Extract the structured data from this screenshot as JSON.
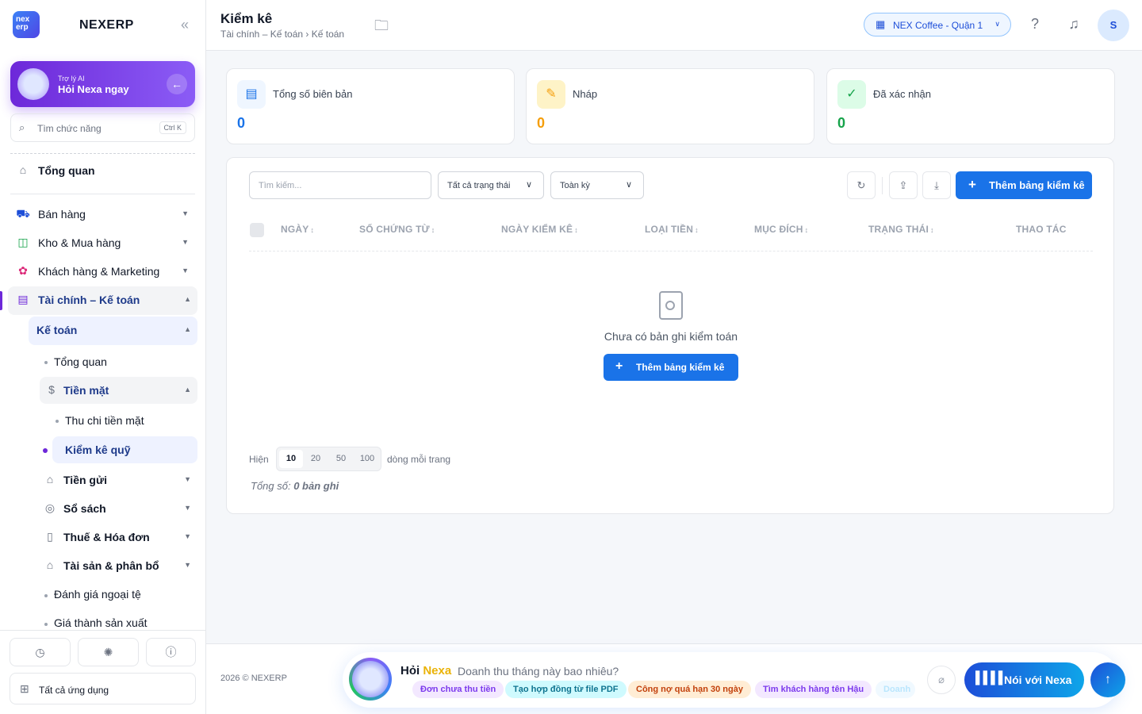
{
  "brand": {
    "logo": "nex erp",
    "name": "NEXERP"
  },
  "ai": {
    "sub": "Trợ lý AI",
    "title": "Hỏi Nexa ngay"
  },
  "search": {
    "placeholder": "Tìm chức năng",
    "shortcut": "Ctrl K"
  },
  "nav": {
    "overview": "Tổng quan",
    "sales": "Bán hàng",
    "stock": "Kho & Mua hàng",
    "crm": "Khách hàng & Marketing",
    "finance": "Tài chính – Kế toán",
    "accounting": "Kế toán",
    "acc_overview": "Tổng quan",
    "cash": "Tiền mặt",
    "cash_flow": "Thu chi tiền mặt",
    "cash_count": "Kiểm kê quỹ",
    "deposit": "Tiền gửi",
    "books": "Sổ sách",
    "tax": "Thuế & Hóa đơn",
    "assets": "Tài sản & phân bổ",
    "fx": "Đánh giá ngoại tệ",
    "cost": "Giá thành sản xuất"
  },
  "all_apps": "Tất cả ứng dụng",
  "header": {
    "title": "Kiểm kê",
    "breadcrumb": "Tài chính – Kế toán › Kế toán",
    "branch": "NEX Coffee - Quận 1",
    "avatar": "S"
  },
  "stats": [
    {
      "label": "Tổng số biên bản",
      "value": "0",
      "color": "#1a73e8"
    },
    {
      "label": "Nháp",
      "value": "0",
      "color": "#f59e0b"
    },
    {
      "label": "Đã xác nhận",
      "value": "0",
      "color": "#16a34a"
    }
  ],
  "filters": {
    "search_placeholder": "Tìm kiếm...",
    "status": "Tất cả trạng thái",
    "period": "Toàn kỳ",
    "add": "Thêm bảng kiểm kê"
  },
  "columns": [
    "NGÀY",
    "SỐ CHỨNG TỪ",
    "NGÀY KIỂM KÊ",
    "LOẠI TIỀN",
    "MỤC ĐÍCH",
    "TRẠNG THÁI",
    "THAO TÁC"
  ],
  "empty": {
    "text": "Chưa có bản ghi kiểm toán",
    "add": "Thêm bảng kiểm kê"
  },
  "pagination": {
    "show": "Hiện",
    "sizes": [
      "10",
      "20",
      "50",
      "100"
    ],
    "per_page": "dòng mỗi trang",
    "total_label": "Tổng số:",
    "total_value": "0 bản ghi"
  },
  "footer": {
    "copyright": "2026 © NEXERP"
  },
  "ask": {
    "hoi": "Hỏi",
    "nexa": "Nexa",
    "question": "Doanh thu tháng này bao nhiêu?",
    "chips": [
      "Đơn chưa thu tiền",
      "Tạo hợp đồng từ file PDF",
      "Công nợ quá hạn 30 ngày",
      "Tìm khách hàng tên Hậu",
      "Doanh"
    ],
    "talk": "Nói với Nexa"
  }
}
